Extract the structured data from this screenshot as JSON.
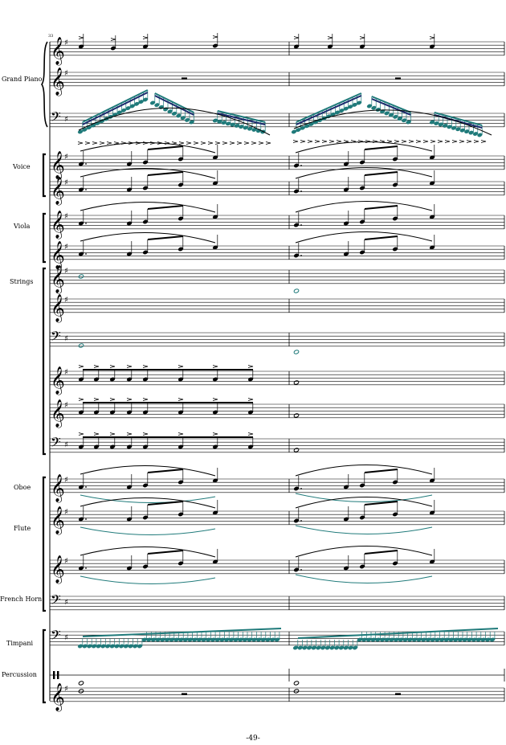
{
  "measure_number": "33",
  "page_number": "-49-",
  "instruments": [
    {
      "label": "Grand Piano"
    },
    {
      "label": "Voice"
    },
    {
      "label": "Viola"
    },
    {
      "label": "Strings"
    },
    {
      "label": "Oboe"
    },
    {
      "label": "Flute"
    },
    {
      "label": "French Horn"
    },
    {
      "label": "Timpani"
    },
    {
      "label": "Percussion"
    }
  ],
  "colors": {
    "ink": "#000000",
    "teal": "#1f7a7a",
    "navy": "#1a2a6c"
  }
}
